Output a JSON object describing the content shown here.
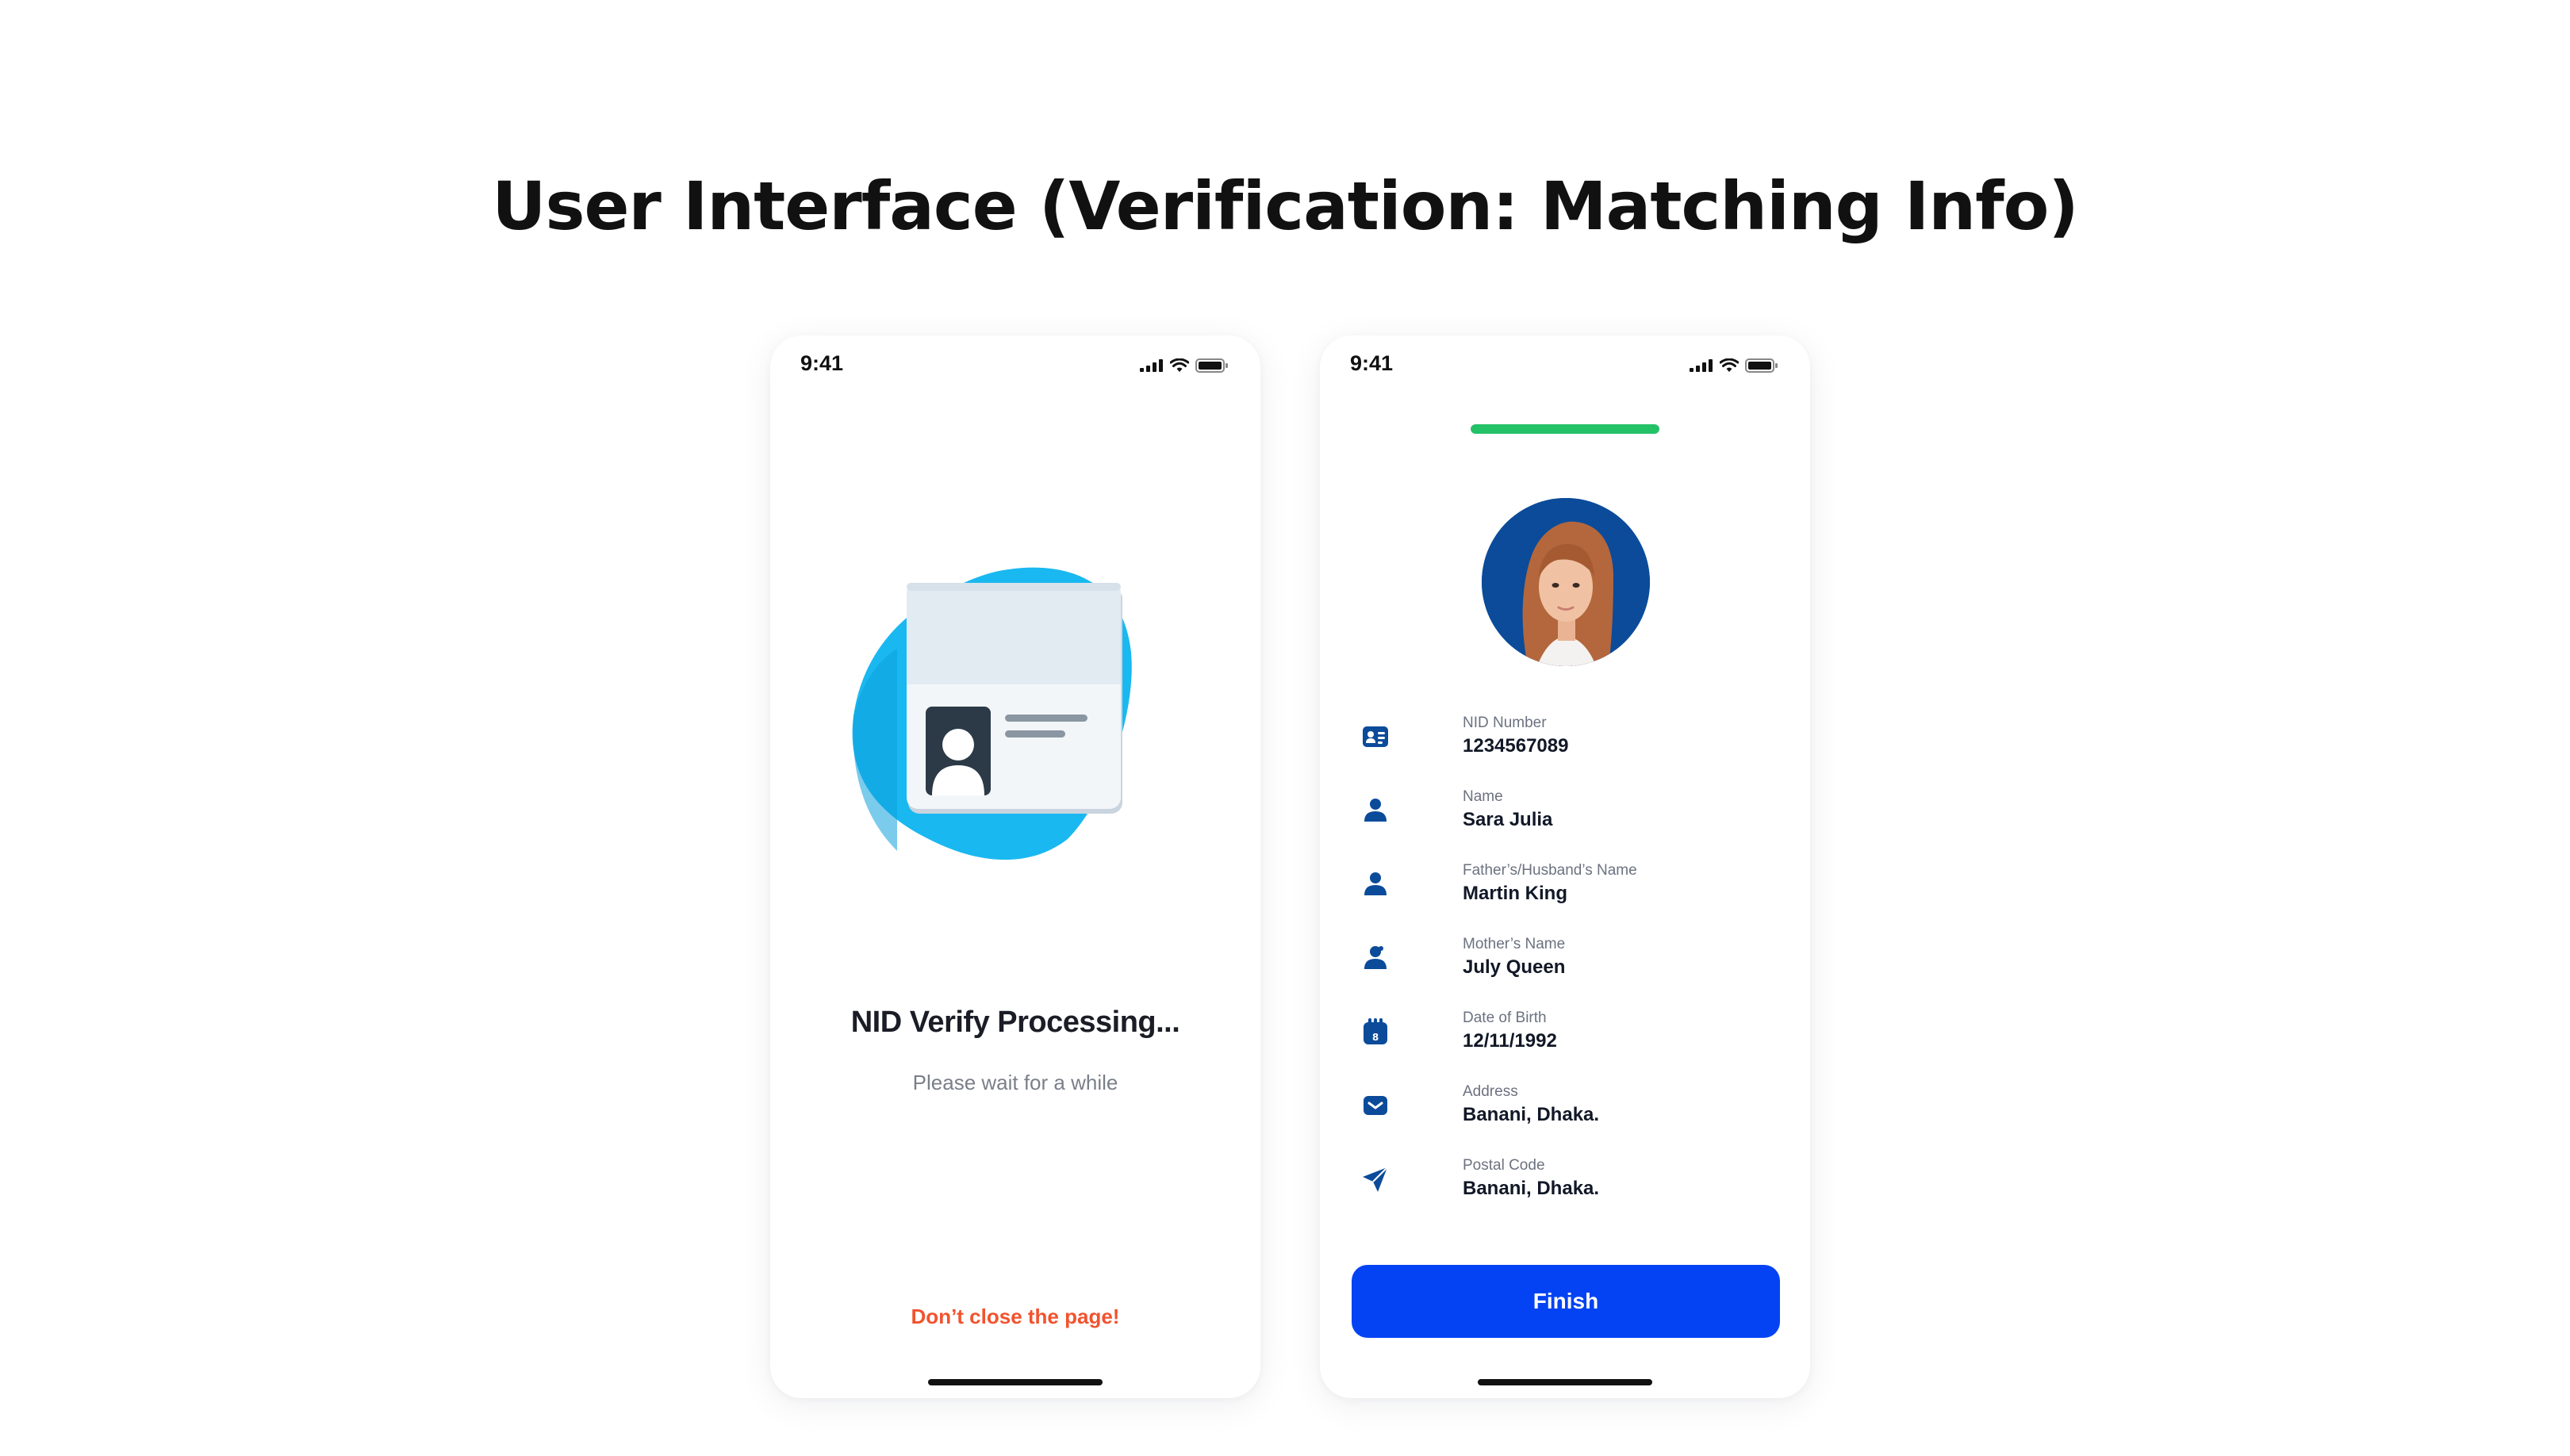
{
  "page": {
    "title": "User Interface (Verification: Matching Info)"
  },
  "colors": {
    "primary": "#0443f3",
    "icon_blue": "#0b4b9a",
    "progress_green": "#24c267",
    "warning_orange": "#f1532e",
    "blob_blue": "#1ab8f0"
  },
  "screen_processing": {
    "status_time": "9:41",
    "illustration": "id-card-icon",
    "title": "NID Verify Processing...",
    "subtitle": "Please wait for a while",
    "warning": "Don’t close the page!"
  },
  "screen_matching": {
    "status_time": "9:41",
    "progress_percent": 100,
    "avatar": "user-photo",
    "fields": [
      {
        "icon": "id-card-icon",
        "label": "NID Number",
        "value": "1234567089"
      },
      {
        "icon": "person-icon",
        "label": "Name",
        "value": "Sara Julia"
      },
      {
        "icon": "person-icon",
        "label": "Father’s/Husband’s Name",
        "value": "Martin King"
      },
      {
        "icon": "person-icon",
        "label": "Mother’s Name",
        "value": "July Queen"
      },
      {
        "icon": "calendar-icon",
        "label": "Date of Birth",
        "value": "12/11/1992"
      },
      {
        "icon": "mail-icon",
        "label": "Address",
        "value": "Banani, Dhaka."
      },
      {
        "icon": "send-icon",
        "label": "Postal Code",
        "value": "Banani, Dhaka."
      }
    ],
    "finish_label": "Finish"
  }
}
